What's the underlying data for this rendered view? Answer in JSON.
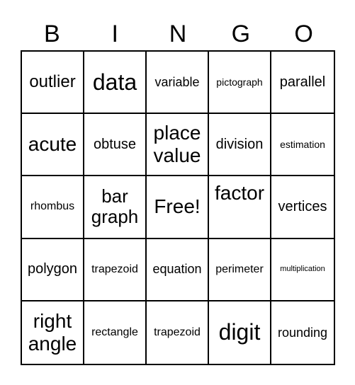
{
  "header": [
    "B",
    "I",
    "N",
    "G",
    "O"
  ],
  "cells": [
    "outlier",
    "data",
    "variable",
    "pictograph",
    "parallel",
    "acute",
    "obtuse",
    "place value",
    "division",
    "estimation",
    "rhombus",
    "bar graph",
    "Free!",
    "factor",
    "vertices",
    "polygon",
    "trapezoid",
    "equation",
    "perimeter",
    "multiplication",
    "right angle",
    "rectangle",
    "trapezoid",
    "digit",
    "rounding"
  ]
}
